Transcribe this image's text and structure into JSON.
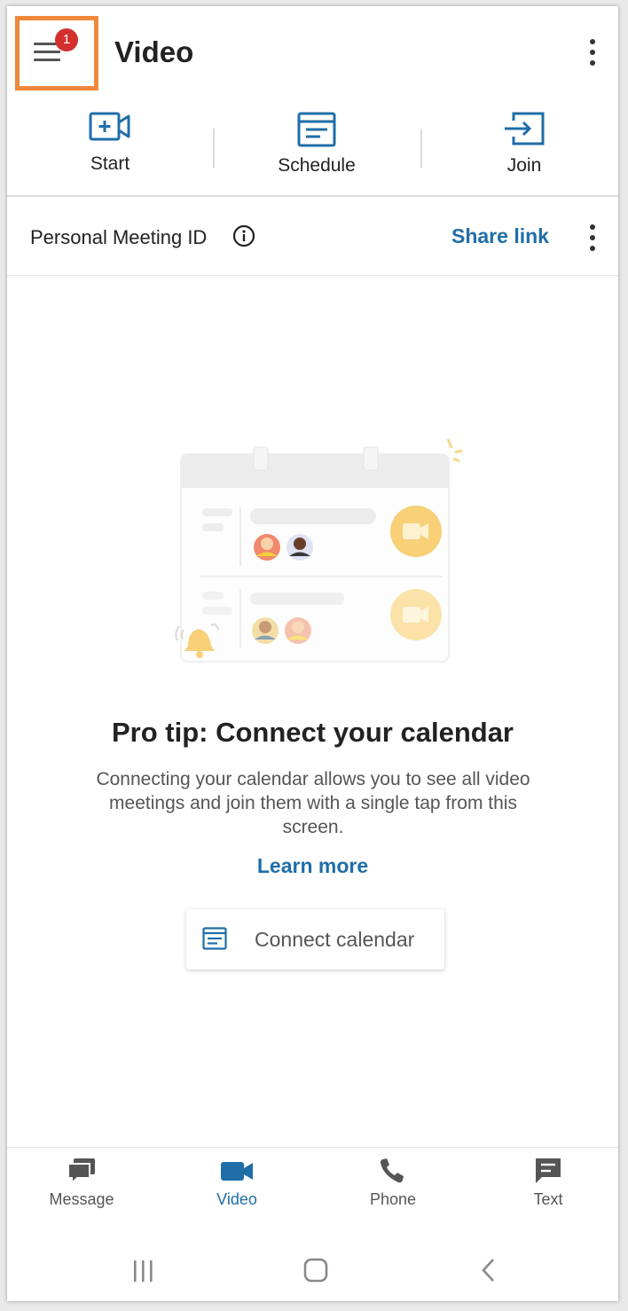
{
  "header": {
    "title": "Video",
    "badge_count": "1"
  },
  "actions": [
    {
      "label": "Start"
    },
    {
      "label": "Schedule"
    },
    {
      "label": "Join"
    }
  ],
  "pmi": {
    "label": "Personal Meeting ID",
    "share_link": "Share link"
  },
  "promo": {
    "title": "Pro tip: Connect your calendar",
    "description": "Connecting your calendar allows you to see all video meetings and join them with a single tap from this screen.",
    "learn_more": "Learn more",
    "connect_button": "Connect calendar"
  },
  "bottom_nav": [
    {
      "label": "Message",
      "icon": "message-icon",
      "active": false
    },
    {
      "label": "Video",
      "icon": "video-icon",
      "active": true
    },
    {
      "label": "Phone",
      "icon": "phone-icon",
      "active": false
    },
    {
      "label": "Text",
      "icon": "text-icon",
      "active": false
    }
  ],
  "colors": {
    "accent": "#1f6ea8",
    "badge": "#d32f2f",
    "highlight": "#f0883a"
  }
}
